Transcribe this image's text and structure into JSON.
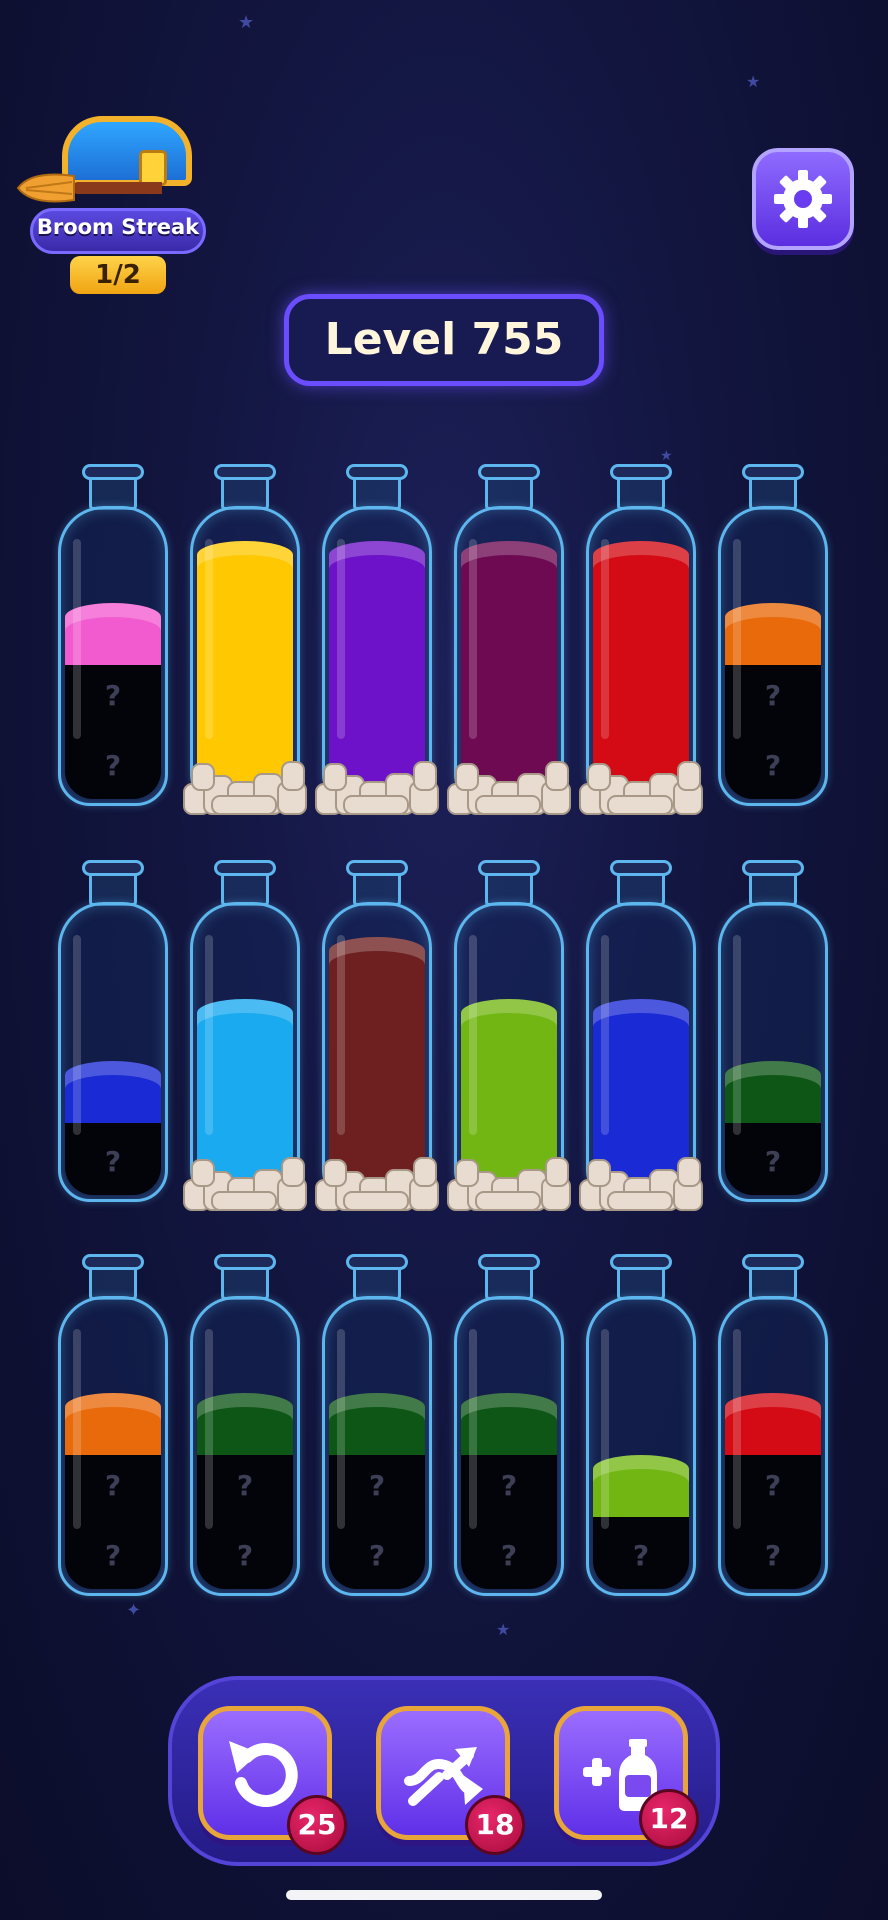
{
  "header": {
    "streak_label": "Broom Streak",
    "streak_count": "1/2",
    "level_label": "Level 755"
  },
  "unknown_mark": "?",
  "colors": {
    "pink": "#f25bd0",
    "yellow": "#ffc800",
    "purple": "#6d12c8",
    "magenta": "#6e0a52",
    "red": "#d40a14",
    "orange": "#e86a0a",
    "blue": "#1a2ad4",
    "sky": "#19aaf0",
    "maroon": "#6e2020",
    "lime": "#72b614",
    "green": "#0d5616"
  },
  "bottles": [
    {
      "id": "r1c1",
      "layers": [
        "?",
        "?",
        "pink"
      ],
      "completed": false
    },
    {
      "id": "r1c2",
      "layers": [
        "yellow",
        "yellow",
        "yellow",
        "yellow"
      ],
      "completed": true
    },
    {
      "id": "r1c3",
      "layers": [
        "purple",
        "purple",
        "purple",
        "purple"
      ],
      "completed": true
    },
    {
      "id": "r1c4",
      "layers": [
        "magenta",
        "magenta",
        "magenta",
        "magenta"
      ],
      "completed": true
    },
    {
      "id": "r1c5",
      "layers": [
        "red",
        "red",
        "red",
        "red"
      ],
      "completed": true
    },
    {
      "id": "r1c6",
      "layers": [
        "?",
        "?",
        "orange"
      ],
      "completed": false
    },
    {
      "id": "r2c1",
      "layers": [
        "?",
        "blue"
      ],
      "completed": false
    },
    {
      "id": "r2c2",
      "layers": [
        "sky",
        "sky",
        "sky"
      ],
      "completed": true
    },
    {
      "id": "r2c3",
      "layers": [
        "maroon",
        "maroon",
        "maroon",
        "maroon"
      ],
      "completed": true
    },
    {
      "id": "r2c4",
      "layers": [
        "lime",
        "lime",
        "lime"
      ],
      "completed": true
    },
    {
      "id": "r2c5",
      "layers": [
        "blue",
        "blue",
        "blue"
      ],
      "completed": true
    },
    {
      "id": "r2c6",
      "layers": [
        "?",
        "green"
      ],
      "completed": false
    },
    {
      "id": "r3c1",
      "layers": [
        "?",
        "?",
        "orange"
      ],
      "completed": false
    },
    {
      "id": "r3c2",
      "layers": [
        "?",
        "?",
        "green"
      ],
      "completed": false
    },
    {
      "id": "r3c3",
      "layers": [
        "?",
        "?",
        "green"
      ],
      "completed": false
    },
    {
      "id": "r3c4",
      "layers": [
        "?",
        "?",
        "green"
      ],
      "completed": false
    },
    {
      "id": "r3c5",
      "layers": [
        "?",
        "lime"
      ],
      "completed": false
    },
    {
      "id": "r3c6",
      "layers": [
        "?",
        "?",
        "red"
      ],
      "completed": false
    }
  ],
  "powerups": {
    "undo": {
      "icon": "undo-icon",
      "count": "25"
    },
    "shuffle": {
      "icon": "shuffle-icon",
      "count": "18"
    },
    "add_bottle": {
      "icon": "add-bottle-icon",
      "count": "12"
    }
  }
}
